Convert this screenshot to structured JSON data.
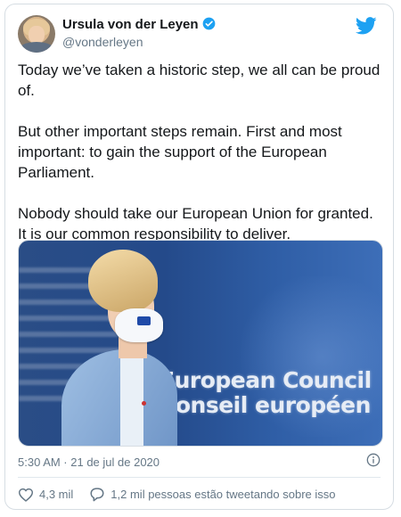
{
  "user": {
    "name": "Ursula von der Leyen",
    "handle": "@vonderleyen"
  },
  "tweet": {
    "paragraphs": [
      "Today we’ve taken a historic step, we all can be proud of.",
      "But other important steps remain. First and most important: to gain the support of the European Parliament.",
      "Nobody should take our European Union for granted. It is our common responsibility to deliver."
    ]
  },
  "media": {
    "sign_line1": "European Council",
    "sign_line2": "Conseil européen"
  },
  "meta": {
    "timestamp": "5:30 AM · 21 de jul de 2020"
  },
  "actions": {
    "likes": "4,3 mil",
    "replies": "1,2 mil pessoas estão tweetando sobre isso"
  },
  "colors": {
    "twitter_blue": "#1da1f2",
    "text_secondary": "#657786",
    "like_icon": "#657786"
  },
  "icons": {
    "verified": "verified-badge-icon",
    "brand": "twitter-bird-icon",
    "info": "info-icon",
    "like": "heart-icon",
    "reply": "speech-bubble-icon"
  }
}
